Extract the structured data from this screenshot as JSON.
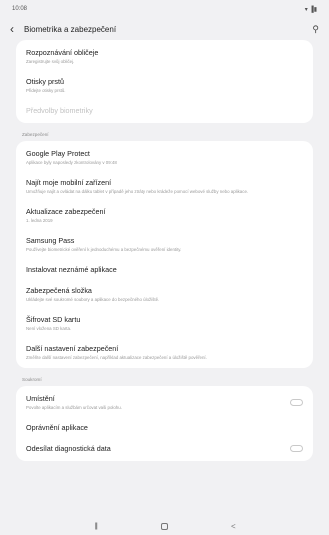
{
  "status": {
    "time": "10:08",
    "icons": "▾ ▐▮"
  },
  "header": {
    "title": "Biometrika a zabezpečení",
    "back_icon": "back-arrow-icon",
    "search_icon": "search-icon"
  },
  "card1": [
    {
      "title": "Rozpoznávání obličeje",
      "sub": "Zaregistrujte svůj obličej."
    },
    {
      "title": "Otisky prstů",
      "sub": "Přidejte otisky prstů."
    },
    {
      "title": "Předvolby biometriky",
      "sub": ""
    }
  ],
  "section_security": "Zabezpečení",
  "card2": [
    {
      "title": "Google Play Protect",
      "sub": "Aplikace byly naposledy zkontrolovány v 09:48"
    },
    {
      "title": "Najít moje mobilní zařízení",
      "sub": "Umožňuje najít a ovládat na dálku tablet v případě jeho ztráty nebo krádeže pomocí webové služby nebo aplikace."
    },
    {
      "title": "Aktualizace zabezpečení",
      "sub": "1. ledna 2019"
    },
    {
      "title": "Samsung Pass",
      "sub": "Používejte biometrické ověření k jednoduchému a bezpečnému ověření identity."
    },
    {
      "title": "Instalovat neznámé aplikace",
      "sub": ""
    },
    {
      "title": "Zabezpečená složka",
      "sub": "Ukládejte své soukromé soubory a aplikace do bezpečného úložiště."
    },
    {
      "title": "Šifrovat SD kartu",
      "sub": "Není vložena SD karta."
    },
    {
      "title": "Další nastavení zabezpečení",
      "sub": "Změňte další nastavení zabezpečení, například aktualizace zabezpečení a úložiště pověření."
    }
  ],
  "section_privacy": "Soukromí",
  "card3": [
    {
      "title": "Umístění",
      "sub": "Povolte aplikacím a službám určovat vaši polohu.",
      "toggle": true
    },
    {
      "title": "Oprávnění aplikace",
      "sub": "",
      "toggle": false
    },
    {
      "title": "Odesílat diagnostická data",
      "sub": "",
      "toggle": true
    }
  ],
  "nav": {
    "recent": "|||",
    "back": "<"
  }
}
